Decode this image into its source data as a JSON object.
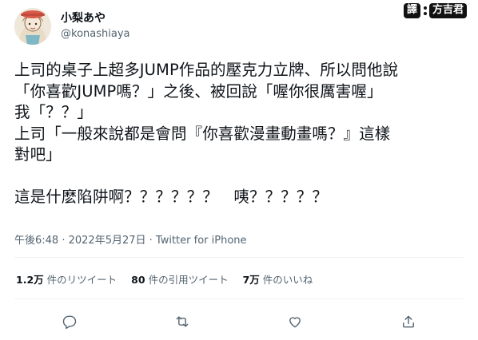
{
  "author": {
    "display_name": "小梨あや",
    "handle": "@konashiaya"
  },
  "credit": {
    "tag": "譯",
    "name": "方吉君"
  },
  "tweet": {
    "lines": [
      "上司的桌子上超多JUMP作品的壓克力立牌、所以問他說",
      "「你喜歡JUMP嗎？」之後、被回說「喔你很厲害喔」",
      "我「？？」",
      "上司「一般來說都是會問『你喜歡漫畫動畫嗎？』這樣",
      "對吧」",
      "",
      "這是什麽陷阱啊？？？？？？　咦？？？？？"
    ]
  },
  "meta": {
    "time": "午後6:48",
    "separator1": " · ",
    "date": "2022年5月27日",
    "separator2": " · ",
    "source": "Twitter for iPhone"
  },
  "stats": {
    "retweets_count": "1.2万",
    "retweets_label": "件のリツイート",
    "quotes_count": "80",
    "quotes_label": "件の引用ツイート",
    "likes_count": "7万",
    "likes_label": "件のいいね"
  },
  "icons": {
    "reply": "reply-icon",
    "retweet": "retweet-icon",
    "like": "heart-icon",
    "share": "share-icon"
  },
  "colors": {
    "text": "#0f1419",
    "secondary": "#536471",
    "divider": "#eff3f4"
  }
}
